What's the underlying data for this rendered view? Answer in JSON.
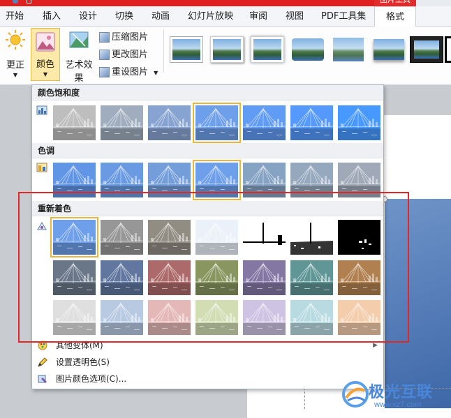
{
  "window": {
    "context_tab_title": "图片工具"
  },
  "tabs": [
    {
      "label": "开始"
    },
    {
      "label": "插入"
    },
    {
      "label": "设计"
    },
    {
      "label": "切换"
    },
    {
      "label": "动画"
    },
    {
      "label": "幻灯片放映"
    },
    {
      "label": "审阅"
    },
    {
      "label": "视图"
    },
    {
      "label": "PDF工具集"
    },
    {
      "label": "格式"
    }
  ],
  "ribbon": {
    "correct_label": "更正",
    "color_label": "颜色",
    "art_effects_label": "艺术效果",
    "compress_label": "压缩图片",
    "change_label": "更改图片",
    "reset_label": "重设图片"
  },
  "dropdown": {
    "saturation_header": "颜色饱和度",
    "tone_header": "色调",
    "recolor_header": "重新着色",
    "saturation_tints": [
      "#b0b0b0",
      "#8a9cb0",
      "#6d8fc7",
      "#4f8ae6",
      "#3e86f2",
      "#2f83fb",
      "#1f82ff"
    ],
    "tone_tints": [
      "#3f7ee0",
      "#4a86dc",
      "#5689d2",
      "#4f8ae6",
      "#6c8fb8",
      "#7f95b0",
      "#8b97a8"
    ],
    "recolor_rows": [
      [
        "#4f8ae6",
        "#808080",
        "#7a7468",
        "#e6eef7",
        "bw-high",
        "bw-mid",
        "bw-low"
      ],
      [
        "#4a5a70",
        "#3f5a8a",
        "#9c4a4a",
        "#6f7f3e",
        "#6a5a90",
        "#3f7f80",
        "#a0642a"
      ],
      [
        "#d8d8d8",
        "#a9bedc",
        "#e0a9a9",
        "#c8d6a4",
        "#c4b6dc",
        "#a9d4dc",
        "#f2c29a"
      ]
    ],
    "menu": {
      "more_variants": "其他变体(M)",
      "set_transparent": "设置透明色(S)",
      "color_options": "图片颜色选项(C)..."
    }
  },
  "watermark": {
    "title": "极光互联",
    "url": "www.xz7.com"
  }
}
